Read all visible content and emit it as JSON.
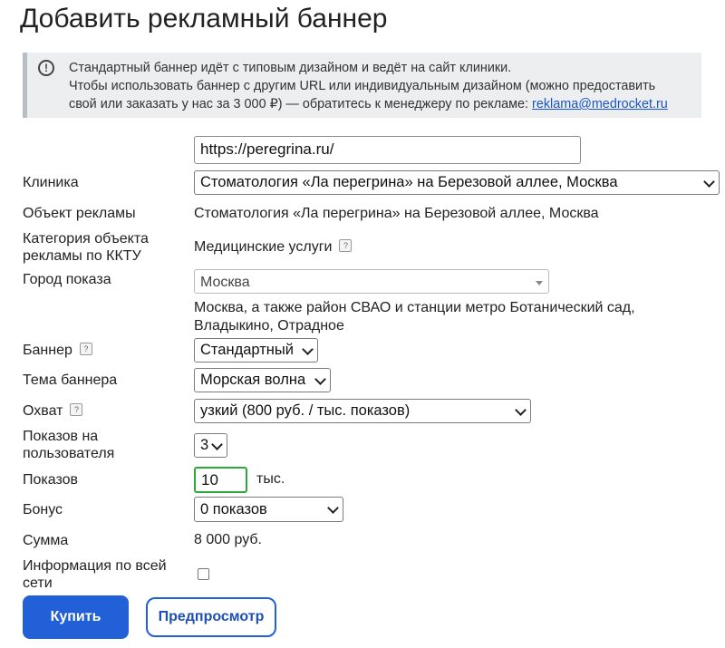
{
  "page": {
    "title": "Добавить рекламный баннер"
  },
  "notice": {
    "line1": "Стандартный баннер идёт с типовым дизайном и ведёт на сайт клиники.",
    "line2": "Чтобы использовать баннер с другим URL или индивидуальным дизайном (можно предоставить",
    "line3_prefix": "свой или заказать у нас за 3 000 ₽) — обратитесь к менеджеру по рекламе: ",
    "email": "reklama@medrocket.ru"
  },
  "form": {
    "url": {
      "value": "https://peregrina.ru/"
    },
    "clinic": {
      "label": "Клиника",
      "value": "Стоматология «Ла перегрина» на Березовой аллее, Москва"
    },
    "ad_object": {
      "label": "Объект рекламы",
      "value": "Стоматология «Ла перегрина» на Березовой аллее, Москва"
    },
    "ktru_category": {
      "label_line1": "Категория объекта",
      "label_line2": "рекламы по ККТУ",
      "value": "Медицинские услуги"
    },
    "city": {
      "label": "Город показа",
      "value": "Москва",
      "coverage_line1": "Москва, а также район СВАО и станции метро Ботанический сад,",
      "coverage_line2": "Владыкино, Отрадное"
    },
    "banner": {
      "label": "Баннер",
      "value": "Стандартный"
    },
    "theme": {
      "label": "Тема баннера",
      "value": "Морская волна"
    },
    "reach": {
      "label": "Охват",
      "value": "узкий (800 руб. / тыс. показов)"
    },
    "per_user": {
      "label_line1": "Показов на",
      "label_line2": "пользователя",
      "value": "3"
    },
    "impressions": {
      "label": "Показов",
      "value": "10",
      "unit": "тыс."
    },
    "bonus": {
      "label": "Бонус",
      "value": "0 показов"
    },
    "total": {
      "label": "Сумма",
      "value": "8 000 руб."
    },
    "network_info": {
      "label_line1": "Информация по всей",
      "label_line2": "сети",
      "checked": false
    }
  },
  "help_icon_glyph": "?",
  "buttons": {
    "buy": "Купить",
    "preview": "Предпросмотр"
  }
}
